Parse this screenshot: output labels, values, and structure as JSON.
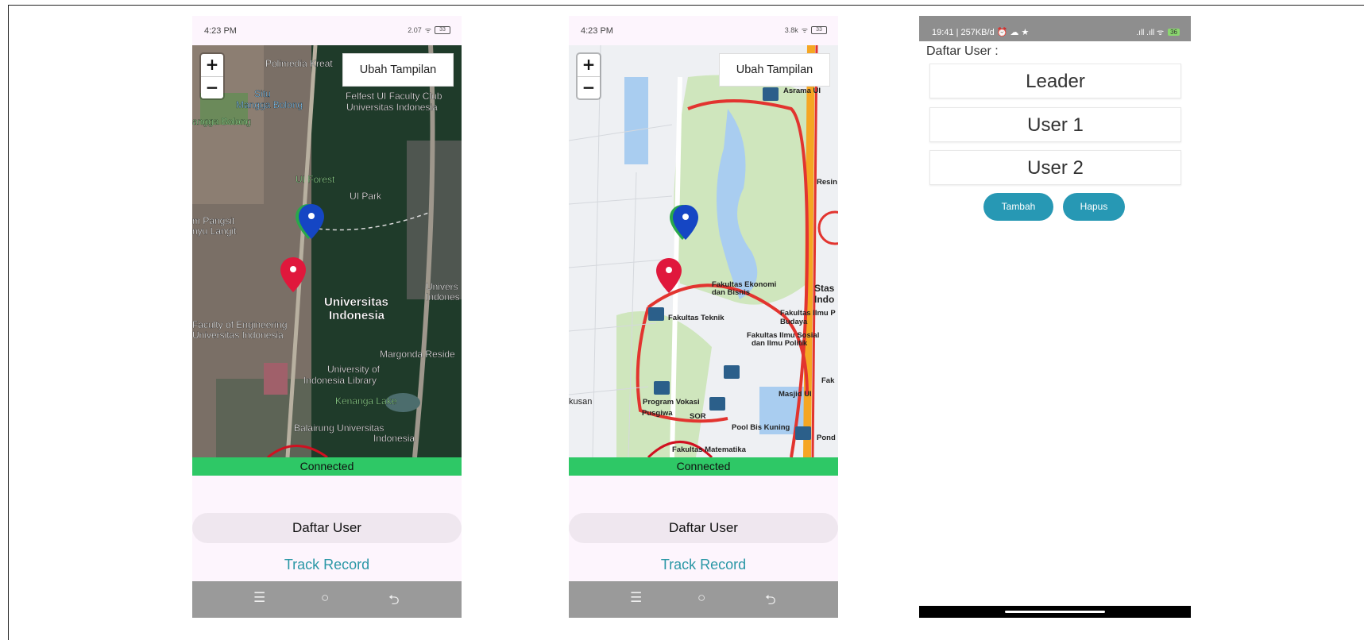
{
  "phone1": {
    "status_time": "4:23 PM",
    "status_speed": "2.07",
    "battery": "33",
    "zoom_in": "+",
    "zoom_out": "−",
    "view_toggle": "Ubah Tampilan",
    "connection": "Connected",
    "map_labels": [
      "Polimedia Kreat",
      "Situ",
      "Mangga Bolong",
      "angga Bolong",
      "Felfest UI Faculty Club",
      "Universitas Indonesia",
      "UI Forest",
      "UI Park",
      "m Pangsit",
      "nyu Langit",
      "Universitas",
      "Indonesia",
      "Faculty of Engineering",
      "Universitas Indonesia",
      "Margonda Reside",
      "University of",
      "Indonesia Library",
      "Kenanga Lake",
      "Balairung Universitas",
      "Indonesia",
      "Univers",
      "Indones"
    ],
    "daftar_user": "Daftar User",
    "track_record": "Track Record",
    "nav_menu": "☰",
    "nav_home": "○",
    "nav_back": "⮌"
  },
  "phone2": {
    "status_time": "4:23 PM",
    "status_speed": "3.8k",
    "battery": "33",
    "zoom_in": "+",
    "zoom_out": "−",
    "view_toggle": "Ubah Tampilan",
    "connection": "Connected",
    "map_labels": [
      "Asrama UI",
      "Fakultas Ekonomi",
      "dan Bisnis",
      "Fakultas Teknik",
      "Fakultas Ilmu P",
      "Budaya",
      "Fakultas Ilmu Sosial",
      "dan Ilmu Politik",
      "Stas",
      "Indo",
      "Masjid UI",
      "Program Vokasi",
      "Pusgiwa",
      "SOR",
      "Pool Bis Kuning",
      "Fakultas Matematika",
      "kusan",
      "Resin",
      "Fak",
      "Pond"
    ],
    "daftar_user": "Daftar User",
    "track_record": "Track Record",
    "nav_menu": "☰",
    "nav_home": "○",
    "nav_back": "⮌"
  },
  "phone3": {
    "status_left": "19:41 | 257KB/d ⏰ ☁ ★",
    "status_signal": ".ıll .ıll ᯤ",
    "battery": "36",
    "title": "Daftar User :",
    "users": [
      "Leader",
      "User 1",
      "User 2"
    ],
    "add_label": "Tambah",
    "delete_label": "Hapus"
  },
  "colors": {
    "connected": "#2ec866",
    "track_record": "#2a97a6",
    "pill": "#2798b4",
    "marker_red": "#e0183c",
    "marker_blue": "#1546c4",
    "marker_green": "#2aa84a"
  }
}
